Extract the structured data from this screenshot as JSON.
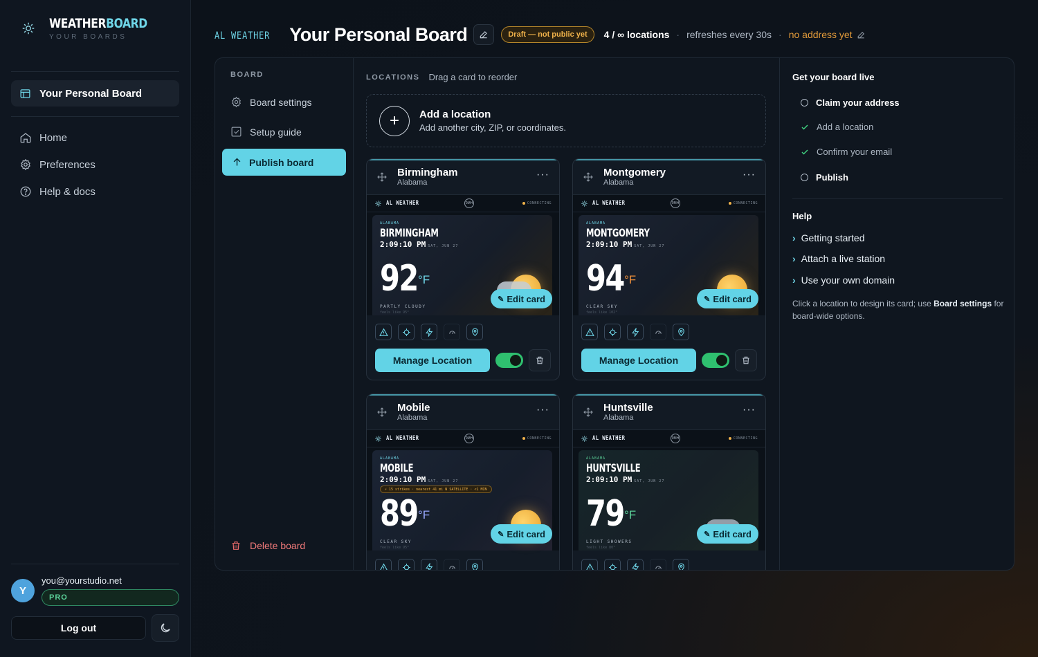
{
  "brand": {
    "word1": "WEATHER",
    "word2": "BOARD",
    "subtitle": "YOUR BOARDS"
  },
  "sidebar": {
    "current_board": "Your Personal Board",
    "nav": [
      {
        "label": "Home",
        "icon": "home-icon"
      },
      {
        "label": "Preferences",
        "icon": "gear-icon"
      },
      {
        "label": "Help & docs",
        "icon": "help-circle-icon"
      }
    ],
    "user": {
      "initial": "Y",
      "email": "you@yourstudio.net",
      "plan": "PRO"
    },
    "logout_label": "Log out"
  },
  "header": {
    "logo_text": "AL WEATHER",
    "title": "Your Personal Board",
    "status_badge": "Draft — not public yet",
    "location_count": "4 / ∞ locations",
    "refresh": "refreshes every 30s",
    "address": "no address yet",
    "separator": "·"
  },
  "board_nav": {
    "section": "BOARD",
    "items": [
      {
        "label": "Board settings",
        "icon": "gear-icon"
      },
      {
        "label": "Setup guide",
        "icon": "checkbox-icon"
      }
    ],
    "publish_label": "Publish board",
    "delete_label": "Delete board"
  },
  "locations": {
    "section": "LOCATIONS",
    "hint": "Drag a card to reorder",
    "add": {
      "title": "Add a location",
      "subtitle": "Add another city, ZIP, or coordinates.",
      "plus": "+"
    },
    "menu_glyph": "···",
    "preview_logo": "AL WEATHER",
    "preview_mph": "0MH",
    "preview_status": "CONNECTING",
    "edit_card_label": "Edit card",
    "manage_label": "Manage Location",
    "cards": [
      {
        "city": "Birmingham",
        "state": "Alabama",
        "pv_state": "ALABAMA",
        "pv_city": "BIRMINGHAM",
        "time": "2:09:10 PM",
        "date": "SAT, JUN 27",
        "temp": "92",
        "unit": "°F",
        "cond": "PARTLY CLOUDY",
        "feels": "feels like 95°",
        "enabled": true
      },
      {
        "city": "Montgomery",
        "state": "Alabama",
        "pv_state": "ALABAMA",
        "pv_city": "MONTGOMERY",
        "time": "2:09:10 PM",
        "date": "SAT, JUN 27",
        "temp": "94",
        "unit": "°F",
        "cond": "CLEAR SKY",
        "feels": "feels like 102°",
        "enabled": true
      },
      {
        "city": "Mobile",
        "state": "Alabama",
        "pv_state": "ALABAMA",
        "pv_city": "MOBILE",
        "time": "2:09:10 PM",
        "date": "SAT, JUN 27",
        "strike": "⚡ 15 strikes · nearest 41 mi N SATELLITE · <1 MIN",
        "temp": "89",
        "unit": "°F",
        "cond": "CLEAR SKY",
        "feels": "feels like 95°"
      },
      {
        "city": "Huntsville",
        "state": "Alabama",
        "pv_state": "ALABAMA",
        "pv_city": "HUNTSVILLE",
        "time": "2:09:10 PM",
        "date": "SAT, JUN 27",
        "temp": "79",
        "unit": "°F",
        "cond": "LIGHT SHOWERS",
        "feels": "feels like 80°"
      }
    ]
  },
  "get_live": {
    "title": "Get your board live",
    "items": [
      {
        "label": "Claim your address",
        "done": false
      },
      {
        "label": "Add a location",
        "done": true
      },
      {
        "label": "Confirm your email",
        "done": true
      },
      {
        "label": "Publish",
        "done": false
      }
    ]
  },
  "help": {
    "title": "Help",
    "links": [
      "Getting started",
      "Attach a live station",
      "Use your own domain"
    ],
    "note_pre": "Click a location to design its card; use ",
    "note_bold": "Board settings",
    "note_post": " for board-wide options."
  },
  "colors": {
    "accent": "#62d3e6",
    "warning": "#f0b24a",
    "success": "#3fcf7f",
    "danger": "#f17a7a"
  }
}
